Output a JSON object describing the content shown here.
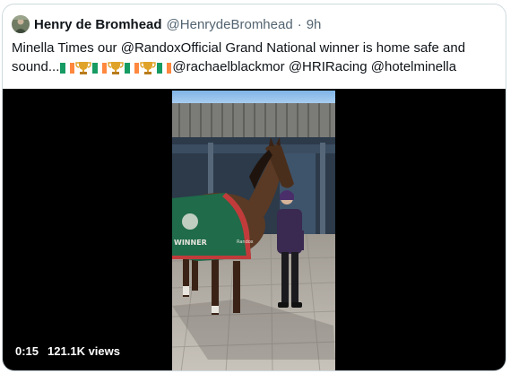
{
  "tweet": {
    "author_name": "Henry de Bromhead",
    "author_handle": "@HenrydeBromhead",
    "separator": "·",
    "time": "9h",
    "text_prefix": "Minella Times our ",
    "mention_randox": "@RandoxOfficial",
    "text_middle": " Grand National winner is home safe and sound...",
    "emoji_sequence": [
      "ireland-flag",
      "trophy",
      "ireland-flag",
      "trophy",
      "ireland-flag",
      "trophy",
      "ireland-flag"
    ],
    "mention_rachael": "@rachaelblackmor",
    "mention_hri": "@HRIRacing",
    "mention_hotel": "@hotelminella"
  },
  "video": {
    "duration": "0:15",
    "views": "121.1K views",
    "rug_text": "Randox"
  },
  "colors": {
    "text": "#0f1419",
    "muted": "#536471",
    "border": "#cfd9de",
    "flag_green": "#169b62",
    "flag_white": "#ffffff",
    "flag_orange": "#ff883e",
    "trophy_gold": "#e0a32a"
  }
}
